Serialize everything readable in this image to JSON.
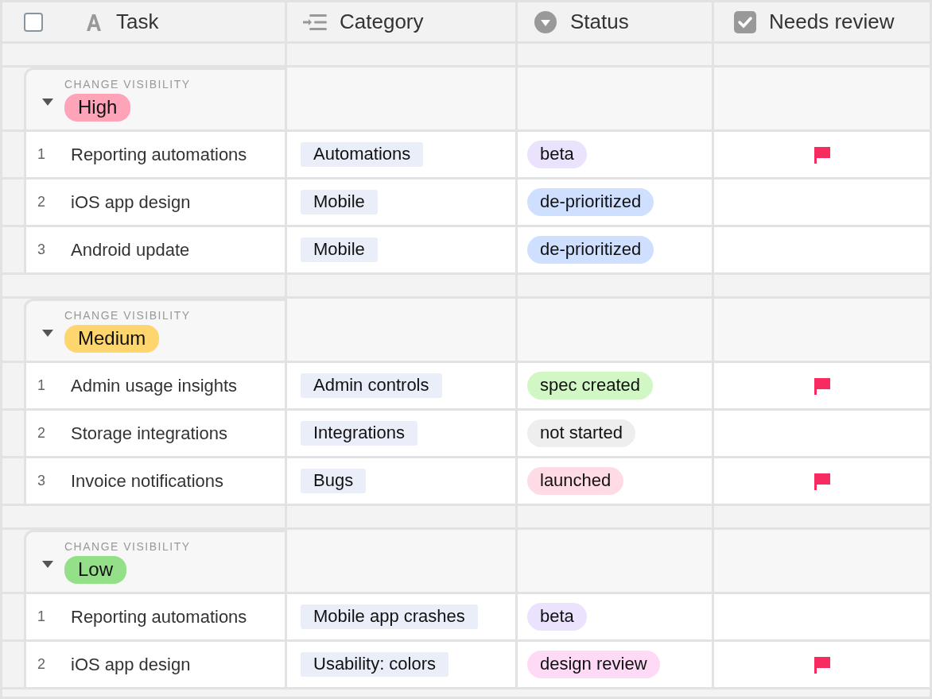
{
  "select_all": {
    "checked": false
  },
  "columns": [
    {
      "kind": "text",
      "label": "Task"
    },
    {
      "kind": "multiselect",
      "label": "Category"
    },
    {
      "kind": "select",
      "label": "Status"
    },
    {
      "kind": "checkbox",
      "label": "Needs review"
    }
  ],
  "groups": [
    {
      "caption": "CHANGE VISIBILITY",
      "label": "High",
      "color": "#ffa3b8",
      "expanded": true,
      "rows": [
        {
          "number": "1",
          "task": "Reporting automations",
          "category": "Automations",
          "status": {
            "label": "beta",
            "color": "#ebe2fe"
          },
          "needs_review": true
        },
        {
          "number": "2",
          "task": "iOS app design",
          "category": "Mobile",
          "status": {
            "label": "de-prioritized",
            "color": "#cfdfff"
          },
          "needs_review": false
        },
        {
          "number": "3",
          "task": "Android update",
          "category": "Mobile",
          "status": {
            "label": "de-prioritized",
            "color": "#cfdfff"
          },
          "needs_review": false
        }
      ]
    },
    {
      "caption": "CHANGE VISIBILITY",
      "label": "Medium",
      "color": "#ffd66e",
      "expanded": true,
      "rows": [
        {
          "number": "1",
          "task": "Admin usage insights",
          "category": "Admin controls",
          "status": {
            "label": "spec created",
            "color": "#d1f7c4"
          },
          "needs_review": true
        },
        {
          "number": "2",
          "task": "Storage integrations",
          "category": "Integrations",
          "status": {
            "label": "not started",
            "color": "#eeeeee"
          },
          "needs_review": false
        },
        {
          "number": "3",
          "task": "Invoice notifications",
          "category": "Bugs",
          "status": {
            "label": "launched",
            "color": "#ffdce5"
          },
          "needs_review": true
        }
      ]
    },
    {
      "caption": "CHANGE VISIBILITY",
      "label": "Low",
      "color": "#93e088",
      "expanded": true,
      "rows": [
        {
          "number": "1",
          "task": "Reporting automations",
          "category": "Mobile app crashes",
          "status": {
            "label": "beta",
            "color": "#ebe2fe"
          },
          "needs_review": false
        },
        {
          "number": "2",
          "task": "iOS app design",
          "category": "Usability: colors",
          "status": {
            "label": "design review",
            "color": "#ffdaf6"
          },
          "needs_review": true
        }
      ]
    }
  ]
}
